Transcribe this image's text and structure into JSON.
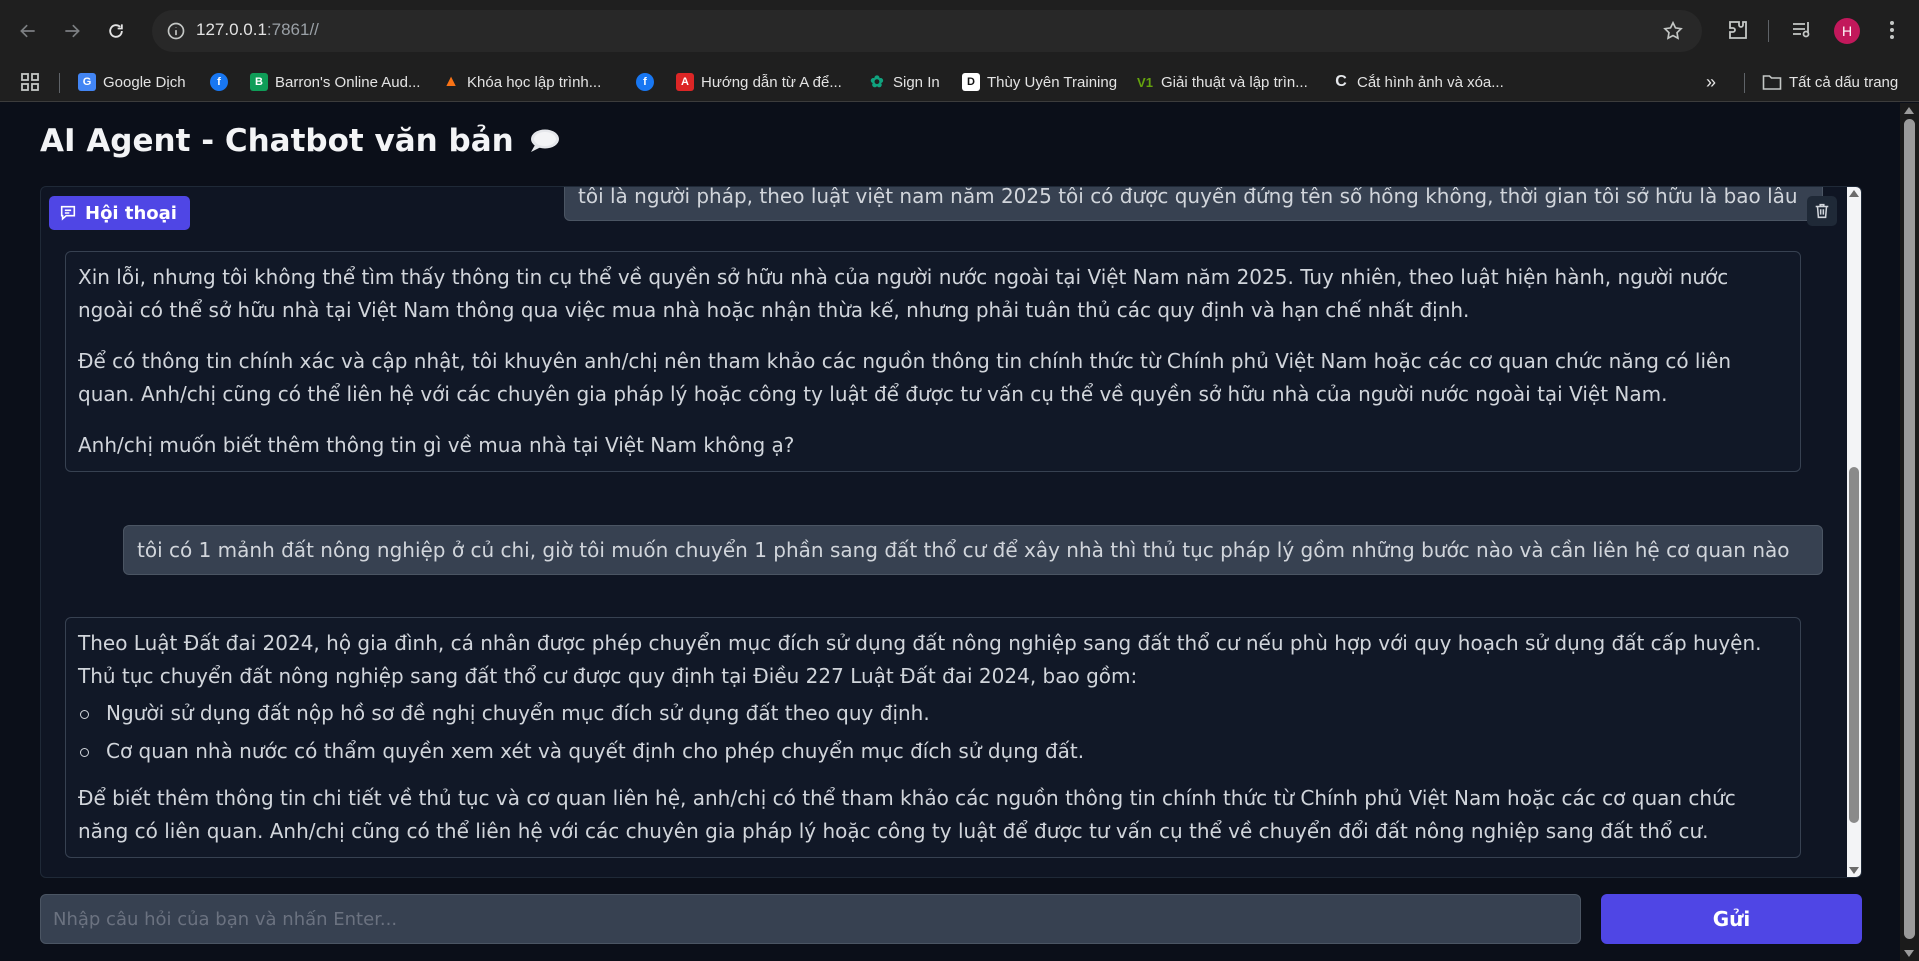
{
  "browser": {
    "url_host": "127.0.0.1",
    "url_rest": ":7861//",
    "profile_initial": "H"
  },
  "bookmarks": {
    "items": [
      {
        "label": "Google Dịch",
        "icon": "google-translate-icon",
        "color": "#4285f4"
      },
      {
        "label": "",
        "icon": "facebook-icon",
        "color": "#1877f2"
      },
      {
        "label": "Barron's Online Aud...",
        "icon": "barrons-icon",
        "color": "#0f9d58"
      },
      {
        "label": "Khóa học lập trình...",
        "icon": "flame-icon",
        "color": "#f97316"
      },
      {
        "label": "",
        "icon": "facebook-icon",
        "color": "#1877f2"
      },
      {
        "label": "Hướng dẫn từ A để...",
        "icon": "book-icon",
        "color": "#dc2626"
      },
      {
        "label": "Sign In",
        "icon": "openai-icon",
        "color": "#10a37f"
      },
      {
        "label": "Thùy Uyên Training",
        "icon": "training-icon",
        "color": "#ffffff"
      },
      {
        "label": "Giải thuật và lập trìn...",
        "icon": "vl-icon",
        "color": "#65a30d"
      },
      {
        "label": "Cắt hình ảnh và xóa...",
        "icon": "c-icon",
        "color": "#e5e7eb"
      }
    ],
    "all_bookmarks_label": "Tất cả dấu trang"
  },
  "app": {
    "title": "AI Agent - Chatbot văn bản",
    "chat_label": "Hội thoại",
    "messages": {
      "user1": "tôi là người pháp, theo luật việt nam năm 2025 tôi có được quyền đứng tên sổ hồng không, thời gian tôi sở hữu là bao lâu",
      "bot1": {
        "p1": "Xin lỗi, nhưng tôi không thể tìm thấy thông tin cụ thể về quyền sở hữu nhà của người nước ngoài tại Việt Nam năm 2025. Tuy nhiên, theo luật hiện hành, người nước ngoài có thể sở hữu nhà tại Việt Nam thông qua việc mua nhà hoặc nhận thừa kế, nhưng phải tuân thủ các quy định và hạn chế nhất định.",
        "p2": "Để có thông tin chính xác và cập nhật, tôi khuyên anh/chị nên tham khảo các nguồn thông tin chính thức từ Chính phủ Việt Nam hoặc các cơ quan chức năng có liên quan. Anh/chị cũng có thể liên hệ với các chuyên gia pháp lý hoặc công ty luật để được tư vấn cụ thể về quyền sở hữu nhà của người nước ngoài tại Việt Nam.",
        "p3": "Anh/chị muốn biết thêm thông tin gì về mua nhà tại Việt Nam không ạ?"
      },
      "user2": "tôi có 1 mảnh đất nông nghiệp ở củ chi, giờ tôi muốn chuyển 1 phần sang đất thổ cư để xây nhà thì thủ tục pháp lý gồm những bước nào và cần liên hệ cơ quan nào",
      "bot2": {
        "p1": "Theo Luật Đất đai 2024, hộ gia đình, cá nhân được phép chuyển mục đích sử dụng đất nông nghiệp sang đất thổ cư nếu phù hợp với quy hoạch sử dụng đất cấp huyện. Thủ tục chuyển đất nông nghiệp sang đất thổ cư được quy định tại Điều 227 Luật Đất đai 2024, bao gồm:",
        "li1": "Người sử dụng đất nộp hồ sơ đề nghị chuyển mục đích sử dụng đất theo quy định.",
        "li2": "Cơ quan nhà nước có thẩm quyền xem xét và quyết định cho phép chuyển mục đích sử dụng đất.",
        "p2": "Để biết thêm thông tin chi tiết về thủ tục và cơ quan liên hệ, anh/chị có thể tham khảo các nguồn thông tin chính thức từ Chính phủ Việt Nam hoặc các cơ quan chức năng có liên quan. Anh/chị cũng có thể liên hệ với các chuyên gia pháp lý hoặc công ty luật để được tư vấn cụ thể về chuyển đổi đất nông nghiệp sang đất thổ cư."
      }
    },
    "input_placeholder": "Nhập câu hỏi của bạn và nhấn Enter...",
    "send_label": "Gửi"
  },
  "colors": {
    "accent": "#4f46e5",
    "page_bg": "#0b0f19",
    "bubble_user": "#374151",
    "bubble_bot": "#111827"
  }
}
